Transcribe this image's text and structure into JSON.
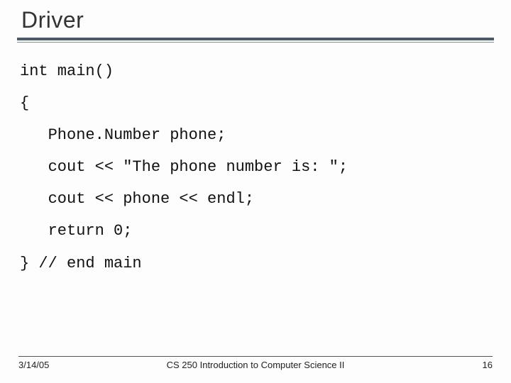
{
  "title": "Driver",
  "code": "int main()\n{\n   Phone.Number phone;\n   cout << \"The phone number is: \";\n   cout << phone << endl;\n   return 0;\n} // end main",
  "footer": {
    "date": "3/14/05",
    "course": "CS 250 Introduction to Computer Science II",
    "page": "16"
  }
}
